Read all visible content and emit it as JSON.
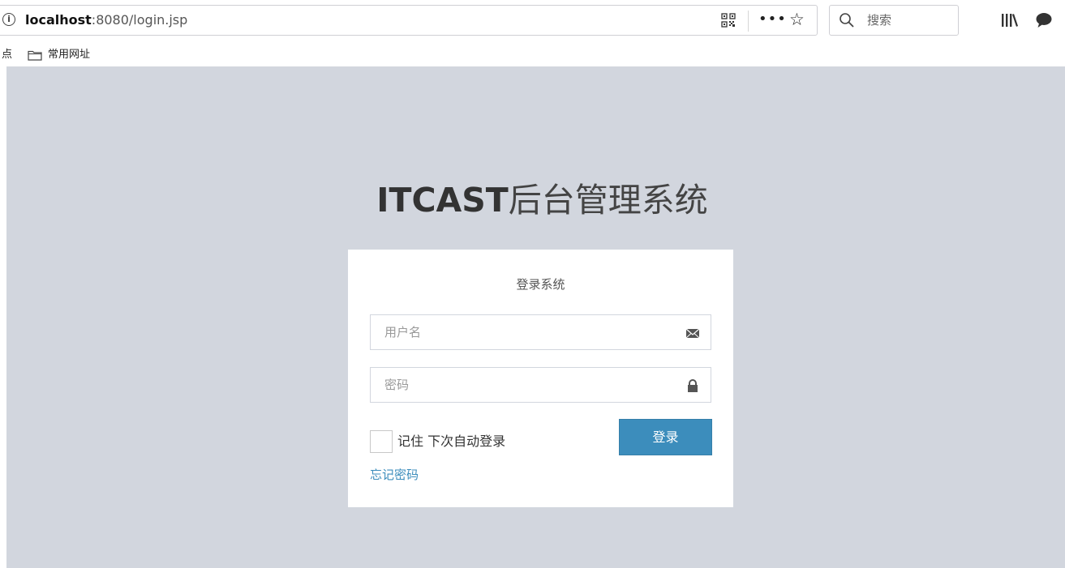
{
  "browser": {
    "url_host": "localhost",
    "url_path": ":8080/login.jsp",
    "info_icon_glyph": "i",
    "search_placeholder": "搜索",
    "more_glyph": "•••",
    "star_glyph": "☆",
    "bookmarks": {
      "cut_label": "点",
      "folder_label": "常用网址"
    }
  },
  "page": {
    "title_bold": "ITCAST",
    "title_rest": "后台管理系统",
    "login_box": {
      "heading": "登录系统",
      "username_placeholder": "用户名",
      "password_placeholder": "密码",
      "remember_label": "记住 下次自动登录",
      "remember_checked": false,
      "submit_label": "登录",
      "forgot_label": "忘记密码"
    }
  },
  "colors": {
    "page_background": "#d2d6de",
    "primary": "#3c8dbc",
    "title_text": "#444444"
  }
}
